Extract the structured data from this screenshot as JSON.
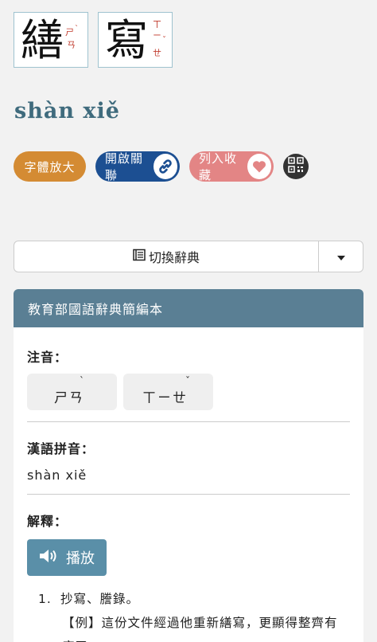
{
  "characters": [
    {
      "glyph": "繕",
      "zhuyin": [
        "ㄕ",
        "ˋ",
        "ㄢ"
      ]
    },
    {
      "glyph": "寫",
      "zhuyin": [
        "ㄒ",
        "ㄧ",
        "ˇ",
        "ㄝ"
      ]
    }
  ],
  "pinyin": "shàn xiě",
  "actions": {
    "zoom_label": "字體放大",
    "link_label": "開啟關聯",
    "fav_label": "列入收藏"
  },
  "switch_dictionary": {
    "label": "切換辭典"
  },
  "card": {
    "title": "教育部國語辭典簡編本",
    "zhuyin_title": "注音：",
    "zhuyin_chips": [
      {
        "text": "ㄕㄢ",
        "tone": "ˋ"
      },
      {
        "text": "ㄒㄧㄝ",
        "tone": "ˇ"
      }
    ],
    "pinyin_title": "漢語拼音：",
    "pinyin_value": "shàn xiě",
    "definition_title": "解釋：",
    "play_label": "播放",
    "definitions": [
      {
        "number": "1.",
        "text": "抄寫、謄錄。",
        "example": "【例】這份文件經過他重新繕寫，更顯得整齊有序了。"
      }
    ]
  },
  "colors": {
    "pinyin": "#3f6b7d",
    "zoom": "#d48b33",
    "link": "#1c4f92",
    "fav": "#e38585",
    "card_header": "#5a7f94",
    "play": "#5a8fa8"
  },
  "icons": [
    "link-icon",
    "heart-icon",
    "qr-code-icon",
    "book-icon",
    "caret-down-icon",
    "speaker-icon"
  ]
}
